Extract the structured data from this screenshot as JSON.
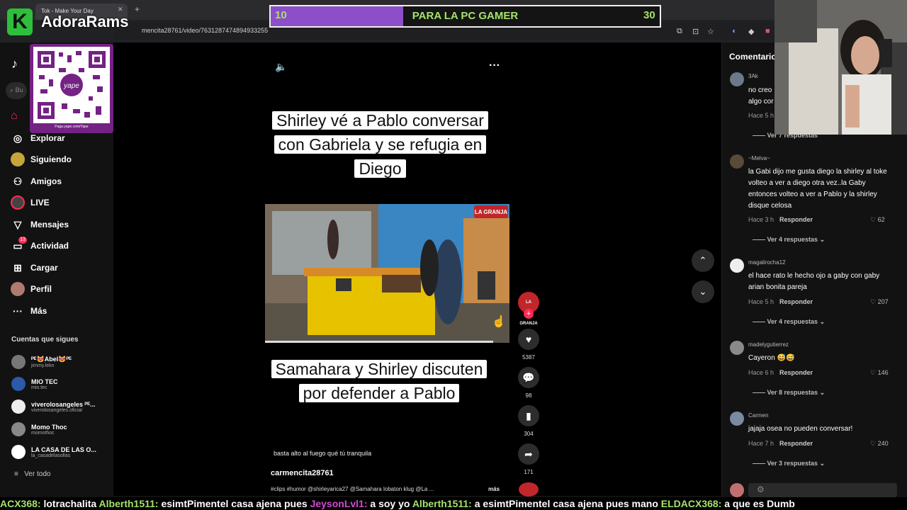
{
  "browser": {
    "tab_title": "Tok - Make Your Day",
    "url": "mencita28761/video/7631287474894933255"
  },
  "overlay": {
    "brand": "AdoraRams",
    "logo_letter": "K",
    "qr_caption": "Paga.yape.com/Yape",
    "goal": {
      "start": "10",
      "label": "PARA LA PC GAMER",
      "end": "30",
      "progress": 0.34
    }
  },
  "sidebar": {
    "search_placeholder": "Bu",
    "items": [
      {
        "label": "Explorar",
        "icon": "compass-icon"
      },
      {
        "label": "Siguiendo",
        "icon": "following-icon"
      },
      {
        "label": "Amigos",
        "icon": "friends-icon"
      },
      {
        "label": "LIVE",
        "icon": "live-icon"
      },
      {
        "label": "Mensajes",
        "icon": "messages-icon"
      },
      {
        "label": "Actividad",
        "icon": "activity-icon"
      },
      {
        "label": "Cargar",
        "icon": "upload-icon"
      },
      {
        "label": "Perfil",
        "icon": "profile-icon"
      },
      {
        "label": "Más",
        "icon": "more-icon"
      }
    ],
    "activity_badge": "13",
    "following_header": "Cuentas que sigues",
    "accounts": [
      {
        "name": "ᴾᴱ😻Abel😻ᴾᴱ",
        "user": "jimmy.lekn"
      },
      {
        "name": "MIO TEC",
        "user": "mio.tec"
      },
      {
        "name": "viverolosangeles ᴾᴱ...",
        "user": "viverolosangeles.oficial"
      },
      {
        "name": "Momo Thoc",
        "user": "momothoc"
      },
      {
        "name": "LA CASA DE LAS O...",
        "user": "la_casadelasollas"
      }
    ],
    "see_all": "Ver todo"
  },
  "video": {
    "caption_top": "Shirley vé a Pablo conversar con Gabriela y se refugia en Diego",
    "caption_bottom": "Samahara y Shirley discuten por defender a Pablo",
    "clip_logo": "LA GRANJA",
    "sound_text": "basta alto al fuego qué tú tranquila",
    "author": "carmencita28761",
    "description": "#clips #humor @shirleyarica27 @Samahara lobaton klug @La ...",
    "more": "más",
    "likes": "5387",
    "comments": "98",
    "saves": "304",
    "shares": "171"
  },
  "comments_panel": {
    "title": "Comentarios",
    "reply_label": "Responder",
    "items": [
      {
        "user": "3Ak",
        "text": "no creo algo cor",
        "time": "Hace 5 h",
        "likes": "",
        "replies": "Ver 7 respuestas"
      },
      {
        "user": "~Melva~",
        "text": "la Gabi dijo me gusta diego la shirley al toke volteo a ver a diego otra vez..la Gaby entonces volteo a ver a Pablo y la shirley disque celosa",
        "time": "Hace 3 h",
        "likes": "62",
        "replies": "Ver 4 respuestas"
      },
      {
        "user": "magalirocha12",
        "text": "el hace rato le hecho ojo a gaby con gaby arian bonita pareja",
        "time": "Hace 5 h",
        "likes": "207",
        "replies": "Ver 4 respuestas"
      },
      {
        "user": "madelygutierrez",
        "text": "Cayeron 😅😅",
        "time": "Hace 6 h",
        "likes": "146",
        "replies": "Ver 8 respuestas"
      },
      {
        "user": "Carmen",
        "text": "jajaja osea no pueden conversar!",
        "time": "Hace 7 h",
        "likes": "240",
        "replies": "Ver 3 respuestas"
      }
    ]
  },
  "ticker": [
    {
      "user": "ACX368:",
      "msg": "lotrachalita",
      "color": "#a3e26b"
    },
    {
      "user": "Alberth1511:",
      "msg": "esimtPimentel casa ajena pues",
      "color": "#a3e26b"
    },
    {
      "user": "JeysonLvl1:",
      "msg": "a soy yo",
      "color": "#d24ad2"
    },
    {
      "user": "Alberth1511:",
      "msg": "a esimtPimentel casa ajena pues mano",
      "color": "#a3e26b"
    },
    {
      "user": "ELDACX368:",
      "msg": "a que es Dumb",
      "color": "#a3e26b"
    }
  ],
  "colors": {
    "accent": "#fe2c55",
    "tiktok_bg": "#121212",
    "goal_fill": "#8c4ec9",
    "goal_text": "#a3e26b"
  }
}
